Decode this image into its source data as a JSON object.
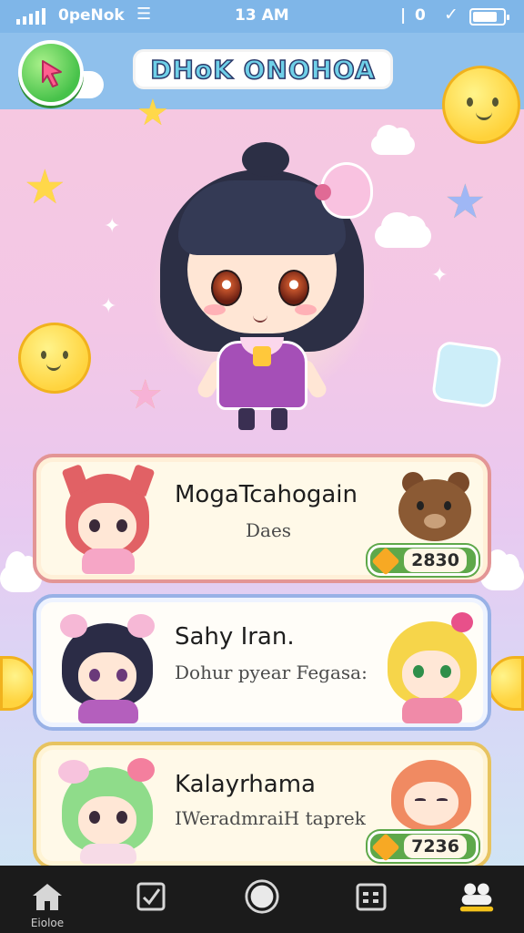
{
  "status_bar": {
    "carrier": "0peNok",
    "time": "13 AM",
    "extra_text": "0",
    "battery_level": 0.8
  },
  "header": {
    "title": "DHoK ONOHOA",
    "back_icon": "arrow-cursor-icon"
  },
  "hero": {
    "character_name": "",
    "accent_colors": {
      "dress": "#a54fb7",
      "hair": "#2c2f45",
      "ribbon": "#f9c2e0"
    }
  },
  "list": {
    "items": [
      {
        "name": "MogaTcahogain",
        "subtitle": "Daes",
        "score": "2830",
        "accent": "#e39595",
        "right_icon": "bear-icon"
      },
      {
        "name": "Sahy Iran.",
        "subtitle": "Dohur pyear Fegasa:",
        "accent": "#98b1e6",
        "right_icon": "blonde-girl-avatar-icon"
      },
      {
        "name": "Kalayrhama",
        "subtitle": "IWeradmraiH taprek",
        "score": "7236",
        "accent": "#e7c35f",
        "right_icon": "redhead-girl-avatar-icon"
      }
    ]
  },
  "navbar": {
    "items": [
      {
        "icon": "home-icon",
        "label": "Eioloe"
      },
      {
        "icon": "checkbox-icon",
        "label": ""
      },
      {
        "icon": "circle-icon",
        "label": ""
      },
      {
        "icon": "calendar-icon",
        "label": ""
      },
      {
        "icon": "profile-icon",
        "label": ""
      }
    ]
  }
}
